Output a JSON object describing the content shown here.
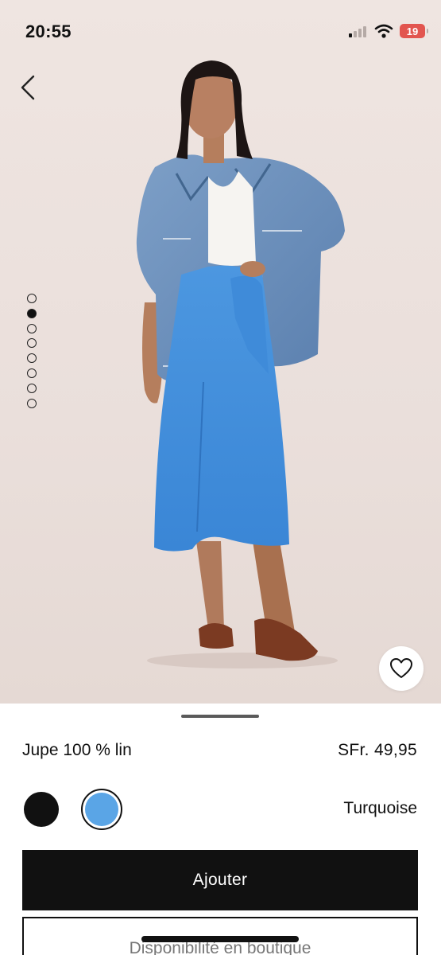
{
  "status_bar": {
    "time": "20:55",
    "battery_level": "19",
    "icons": [
      "cellular-signal-icon",
      "wifi-icon",
      "battery-icon"
    ]
  },
  "gallery": {
    "image_count": 8,
    "active_index": 1,
    "image_description": "model-wearing-denim-jacket-and-blue-linen-wrap-skirt"
  },
  "product": {
    "name": "Jupe 100 % lin",
    "price": "SFr. 49,95"
  },
  "colors": {
    "options": [
      {
        "swatch": "#111111",
        "selected": false
      },
      {
        "swatch": "#5aa5e6",
        "selected": true
      }
    ],
    "selected_name": "Turquoise"
  },
  "actions": {
    "add_label": "Ajouter",
    "store_label": "Disponibilité en boutique"
  }
}
